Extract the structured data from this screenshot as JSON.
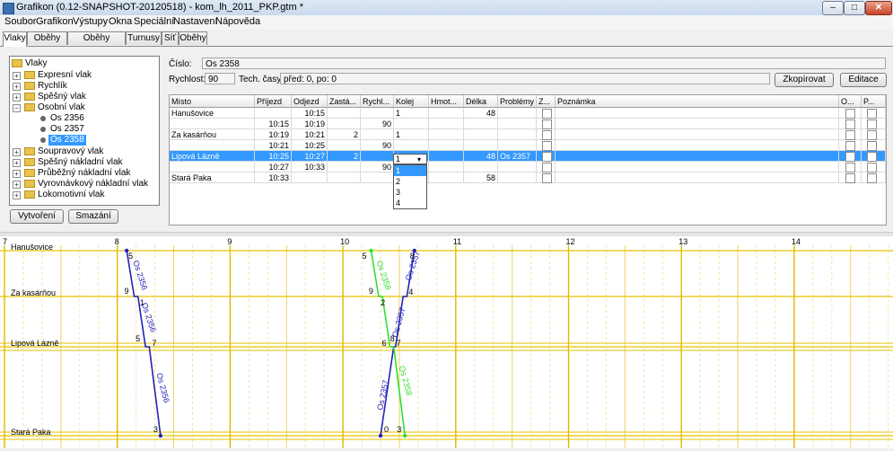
{
  "window": {
    "title": "Grafikon (0.12-SNAPSHOT-20120518) - kom_lh_2011_PKP.gtm *"
  },
  "menu": [
    "Soubor",
    "Grafikon",
    "Výstupy",
    "Okna",
    "Speciální",
    "Nastavení",
    "Nápověda"
  ],
  "tabs": [
    "Vlaky",
    "Oběhy HV",
    "Oběhy souprav",
    "Turnusy",
    "Síť",
    "Oběhy"
  ],
  "tree": {
    "root": "Vlaky",
    "items": [
      "Expresní vlak",
      "Rychlík",
      "Spěšný vlak",
      "Osobní vlak",
      "Os 2356",
      "Os 2357",
      "Os 2358",
      "Soupravový vlak",
      "Spěšný nákladní vlak",
      "Průběžný nákladní vlak",
      "Vyrovnávkový nákladní vlak",
      "Lokomotivní vlak"
    ]
  },
  "buttons": {
    "create": "Vytvoření",
    "delete": "Smazání",
    "copy": "Zkopírovat",
    "edit": "Editace"
  },
  "train": {
    "number_label": "Číslo:",
    "number": "Os 2358",
    "speed_label": "Rychlost:",
    "speed": "90",
    "tech_label": "Tech. časy:",
    "tech": "před: 0, po: 0"
  },
  "table": {
    "headers": [
      "Místo",
      "Příjezd",
      "Odjezd",
      "Zastá...",
      "Rychl...",
      "Kolej",
      "Hmot...",
      "Délka",
      "Problémy",
      "Z...",
      "Poznámka",
      "O...",
      "P..."
    ],
    "rows": [
      {
        "place": "Hanušovice",
        "arr": "",
        "dep": "10:15",
        "stop": "",
        "speed": "",
        "track": "1",
        "weight": "",
        "len": "48",
        "prob": ""
      },
      {
        "place": "",
        "arr": "10:15",
        "dep": "10:19",
        "stop": "",
        "speed": "90",
        "track": "",
        "weight": "",
        "len": "",
        "prob": ""
      },
      {
        "place": "Za kasárňou",
        "arr": "10:19",
        "dep": "10:21",
        "stop": "2",
        "speed": "",
        "track": "1",
        "weight": "",
        "len": "",
        "prob": ""
      },
      {
        "place": "",
        "arr": "10:21",
        "dep": "10:25",
        "stop": "",
        "speed": "90",
        "track": "",
        "weight": "",
        "len": "",
        "prob": ""
      },
      {
        "place": "Lipová Lázně",
        "arr": "10:25",
        "dep": "10:27",
        "stop": "2",
        "speed": "",
        "track": "1",
        "weight": "",
        "len": "48",
        "prob": "Os 2357"
      },
      {
        "place": "",
        "arr": "10:27",
        "dep": "10:33",
        "stop": "",
        "speed": "90",
        "track": "",
        "weight": "",
        "len": "",
        "prob": ""
      },
      {
        "place": "Stará Paka",
        "arr": "10:33",
        "dep": "",
        "stop": "",
        "speed": "",
        "track": "",
        "weight": "",
        "len": "58",
        "prob": ""
      }
    ],
    "track_dropdown": {
      "value": "1",
      "options": [
        "1",
        "2",
        "3",
        "4"
      ]
    }
  },
  "graph": {
    "hours": [
      "7",
      "8",
      "9",
      "10",
      "11",
      "12",
      "13",
      "14"
    ],
    "stations": [
      "Hanušovice",
      "Za kasárňou",
      "Lipová Lázně",
      "Stará Paka"
    ],
    "trains": [
      {
        "name": "Os 2356",
        "color": "#2222b8",
        "labels": [
          "5",
          "9",
          "1",
          "5",
          "7",
          "3"
        ]
      },
      {
        "name": "Os 2357",
        "color": "#2222b8",
        "labels": [
          "8",
          "4",
          "8",
          "7",
          "0"
        ]
      },
      {
        "name": "Os 2358",
        "color": "#33dd33",
        "labels": [
          "5",
          "9",
          "2",
          "6",
          "3"
        ]
      }
    ]
  }
}
